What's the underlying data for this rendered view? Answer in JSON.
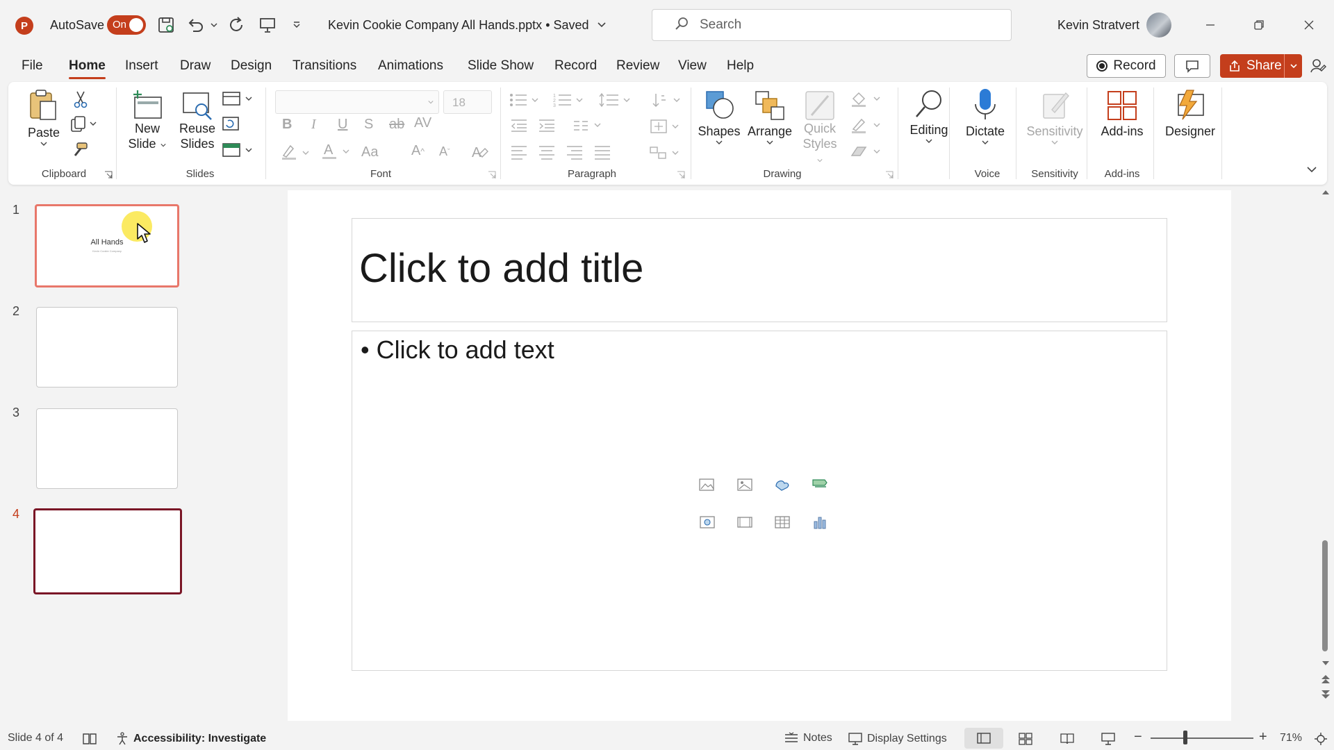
{
  "app": {
    "logo_letter": "P",
    "autosave_label": "AutoSave",
    "autosave_state": "On",
    "doc_title": "Kevin Cookie Company All Hands.pptx",
    "save_status": "• Saved",
    "search_placeholder": "Search",
    "user_name": "Kevin Stratvert",
    "accent_color": "#c43e1c"
  },
  "tabs": [
    "File",
    "Home",
    "Insert",
    "Draw",
    "Design",
    "Transitions",
    "Animations",
    "Slide Show",
    "Record",
    "Review",
    "View",
    "Help"
  ],
  "active_tab": "Home",
  "actions": {
    "record_label": "Record",
    "share_label": "Share"
  },
  "ribbon": {
    "paste": "Paste",
    "new_slide_1": "New",
    "new_slide_2": "Slide",
    "reuse_1": "Reuse",
    "reuse_2": "Slides",
    "font_size": "18",
    "shapes": "Shapes",
    "arrange": "Arrange",
    "quick_styles_1": "Quick",
    "quick_styles_2": "Styles",
    "editing": "Editing",
    "dictate": "Dictate",
    "sensitivity": "Sensitivity",
    "addins": "Add-ins",
    "designer": "Designer",
    "groups": {
      "clipboard": "Clipboard",
      "slides": "Slides",
      "font": "Font",
      "paragraph": "Paragraph",
      "drawing": "Drawing",
      "voice": "Voice",
      "sensitivity": "Sensitivity",
      "addins": "Add-ins"
    }
  },
  "thumbnails": [
    {
      "num": "1",
      "title": "All Hands",
      "subtitle": "Kevin Cookie Company"
    },
    {
      "num": "2",
      "title": "",
      "subtitle": ""
    },
    {
      "num": "3",
      "title": "",
      "subtitle": ""
    },
    {
      "num": "4",
      "title": "",
      "subtitle": ""
    }
  ],
  "slide": {
    "title_placeholder": "Click to add title",
    "body_placeholder": "Click to add text"
  },
  "status": {
    "slide_count": "Slide 4 of 4",
    "accessibility": "Accessibility: Investigate",
    "notes": "Notes",
    "display_settings": "Display Settings",
    "zoom": "71%"
  }
}
